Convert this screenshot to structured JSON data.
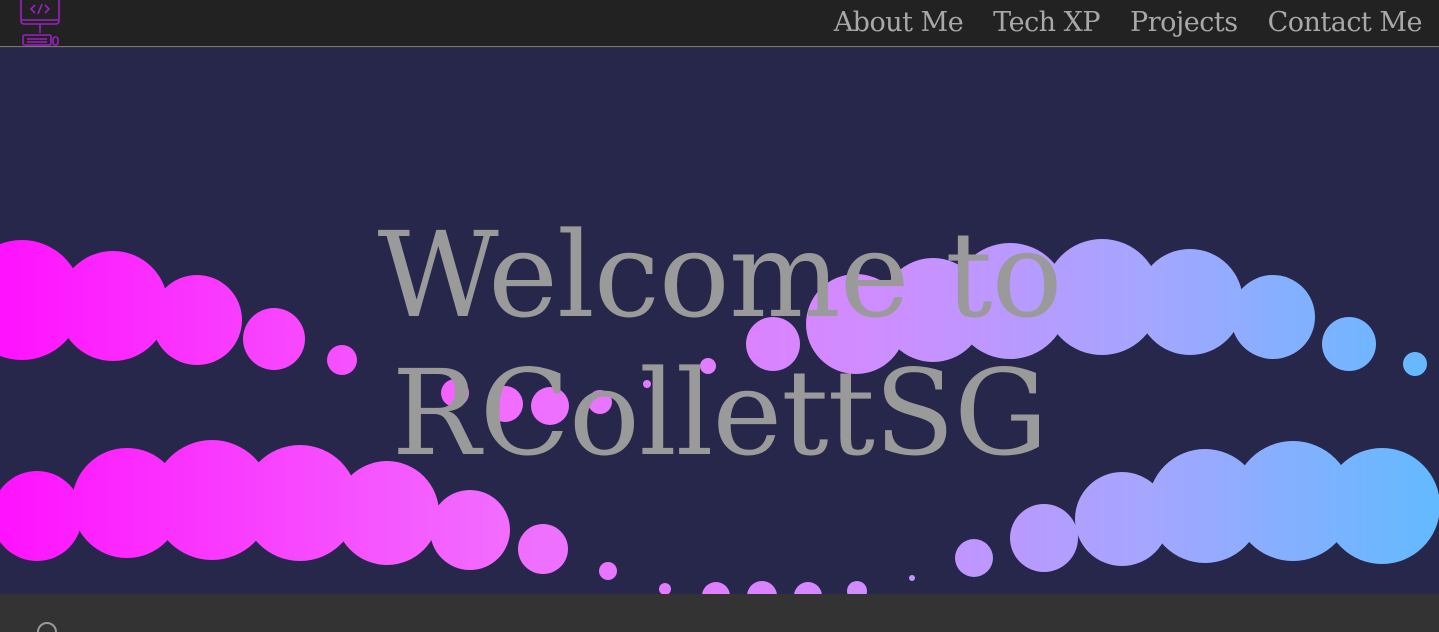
{
  "nav": {
    "logo_icon": "monitor-code-icon",
    "links": [
      "About Me",
      "Tech XP",
      "Projects",
      "Contact Me"
    ]
  },
  "hero": {
    "title_line1": "Welcome to",
    "title_line2": "RCollettSG",
    "background_color": "#27264b",
    "dot_colors": [
      "#ff1aff",
      "#ff5cff",
      "#b9a0ff",
      "#6cb6ff"
    ]
  },
  "footer": {
    "icon": "circle-icon"
  }
}
